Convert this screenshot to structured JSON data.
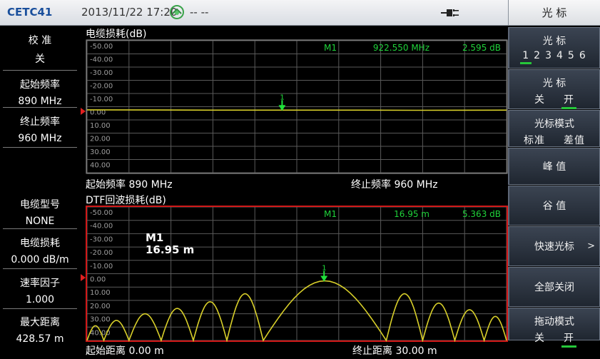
{
  "status_bar": {
    "brand": "CETC41",
    "datetime": "2013/11/22  17:20",
    "gps_icon": "satellite-icon",
    "gps_value": "-- --",
    "battery_icon": "battery-plug-icon"
  },
  "menu": {
    "title": "光 标",
    "softkeys": [
      {
        "name": "marker-select-button",
        "line1": "光 标",
        "options": [
          "1",
          "2",
          "3",
          "4",
          "5",
          "6"
        ],
        "selected": 0
      },
      {
        "name": "marker-onoff-button",
        "line1": "光 标",
        "options": [
          "关",
          "开"
        ],
        "selected": 1
      },
      {
        "name": "marker-mode-button",
        "line1": "光标模式",
        "options": [
          "标准",
          "差值"
        ],
        "selected": 0
      },
      {
        "name": "peak-button",
        "label": "峰 值"
      },
      {
        "name": "valley-button",
        "label": "谷 值"
      },
      {
        "name": "quick-marker-button",
        "label": "快速光标",
        "arrow": ">"
      },
      {
        "name": "all-off-button",
        "label": "全部关闭"
      },
      {
        "name": "drag-mode-button",
        "line1": "拖动模式",
        "options": [
          "关",
          "开"
        ],
        "selected": 1
      }
    ]
  },
  "left_panel": {
    "params": [
      {
        "label": "校 准",
        "value": "关"
      },
      {
        "label": "起始频率",
        "value": "890 MHz"
      },
      {
        "label": "终止频率",
        "value": "960 MHz"
      },
      {
        "label": "电缆型号",
        "value": "NONE"
      },
      {
        "label": "电缆损耗",
        "value": "0.000 dB/m"
      },
      {
        "label": "速率因子",
        "value": "1.000"
      },
      {
        "label": "最大距离",
        "value": "428.57 m"
      }
    ]
  },
  "plot_top": {
    "title": "电缆损耗(dB)",
    "marker": {
      "name": "M1",
      "x_text": "922.550 MHz",
      "y_text": "2.595 dB",
      "number": "1"
    },
    "footer_start": "起始频率 890 MHz",
    "footer_stop": "终止频率 960 MHz"
  },
  "plot_bottom": {
    "title": "DTF回波损耗(dB)",
    "marker": {
      "name": "M1",
      "x_text": "16.95 m",
      "y_text": "5.363 dB",
      "number": "1"
    },
    "big_marker": {
      "name": "M1",
      "value": "16.95 m"
    },
    "footer_start": "起始距离 0.00 m",
    "footer_stop": "终止距离 30.00 m"
  },
  "colors": {
    "trace": "#d8cf2a",
    "marker_text": "#1fd23a",
    "marker_arrow": "#1fe03a",
    "grid": "#5a5a5a",
    "active_border": "#d21818",
    "ref_marker": "#e02020"
  },
  "chart_data": [
    {
      "type": "line",
      "title": "电缆损耗(dB)",
      "y_tick_labels": [
        "-50.00",
        "-40.00",
        "-30.00",
        "-20.00",
        "-10.00",
        "0.00",
        "10.00",
        "20.00",
        "30.00",
        "40.00"
      ],
      "ylim": [
        -50,
        50
      ],
      "y_inverted": true,
      "xlim": [
        890,
        960
      ],
      "grid": true,
      "series": [
        {
          "x": [
            890,
            900,
            910,
            922.55,
            935,
            945,
            960
          ],
          "y": [
            2.4,
            2.5,
            2.6,
            2.595,
            2.6,
            2.7,
            2.6
          ]
        }
      ],
      "marker": {
        "x": 922.55,
        "y": 2.595
      }
    },
    {
      "type": "line",
      "title": "DTF回波损耗(dB)",
      "y_tick_labels": [
        "-50.00",
        "-40.00",
        "-30.00",
        "-20.00",
        "-10.00",
        "0.00",
        "10.00",
        "20.00",
        "30.00",
        "40.00"
      ],
      "ylim": [
        -50,
        50
      ],
      "y_inverted": true,
      "xlim": [
        0,
        30
      ],
      "grid": true,
      "series": [
        {
          "lobes": [
            {
              "x_start": 0.0,
              "x_end": 1.2,
              "peak": 39
            },
            {
              "x_start": 1.2,
              "x_end": 3.0,
              "peak": 35
            },
            {
              "x_start": 3.0,
              "x_end": 5.3,
              "peak": 30
            },
            {
              "x_start": 5.3,
              "x_end": 7.6,
              "peak": 26
            },
            {
              "x_start": 7.6,
              "x_end": 10.0,
              "peak": 21
            },
            {
              "x_start": 10.0,
              "x_end": 12.6,
              "peak": 15
            },
            {
              "x_start": 12.6,
              "x_end": 21.4,
              "peak": 5.363
            },
            {
              "x_start": 21.4,
              "x_end": 24.0,
              "peak": 15
            },
            {
              "x_start": 24.0,
              "x_end": 26.3,
              "peak": 22
            },
            {
              "x_start": 26.3,
              "x_end": 28.4,
              "peak": 27
            },
            {
              "x_start": 28.4,
              "x_end": 30.0,
              "peak": 32
            }
          ],
          "lobe_floor": 50
        }
      ],
      "marker": {
        "x": 16.95,
        "y": 5.363
      }
    }
  ]
}
